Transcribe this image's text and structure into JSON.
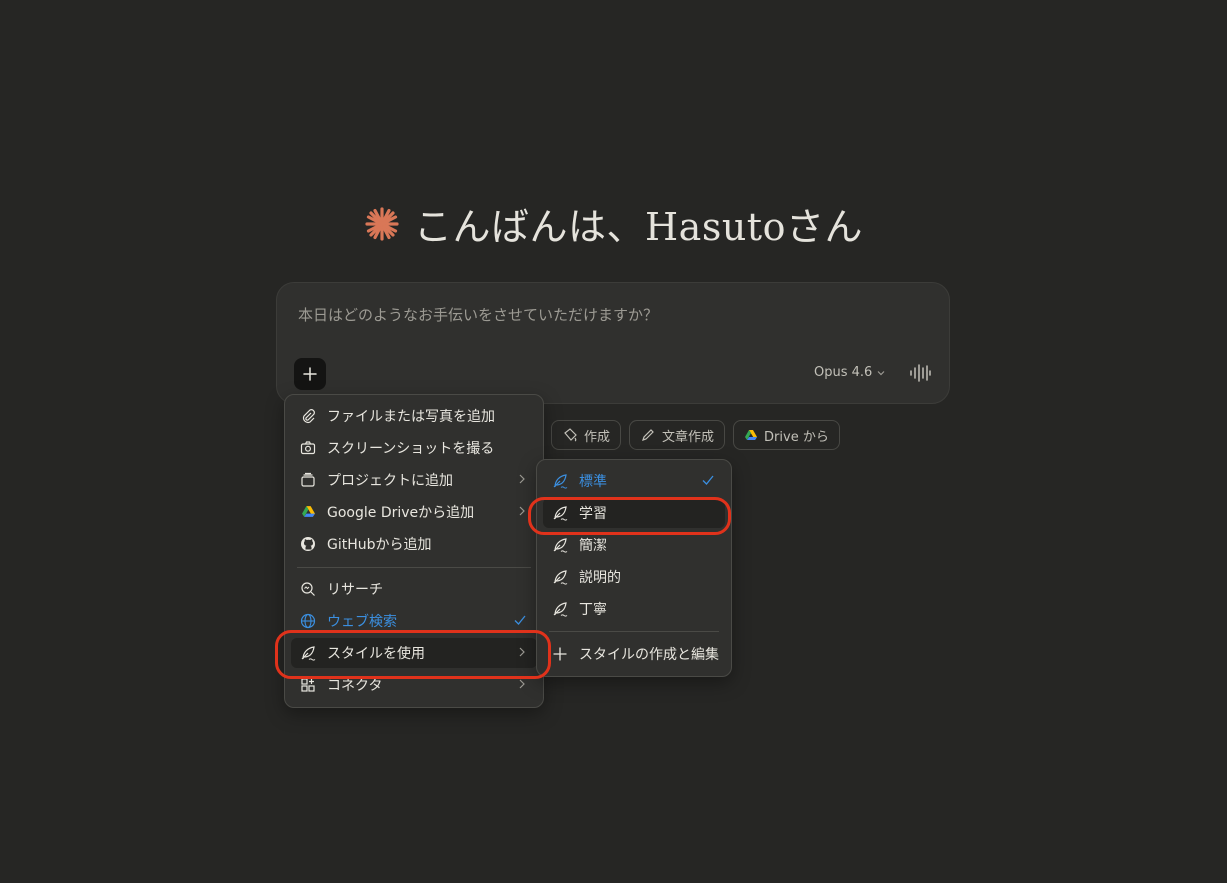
{
  "greeting": {
    "text": "こんばんは、Hasutoさん",
    "accent_color": "#d97757"
  },
  "composer": {
    "placeholder": "本日はどのようなお手伝いをさせていただけますか？",
    "model_label": "Opus 4.6",
    "plus_icon": "plus-icon",
    "voice_icon": "voice-icon"
  },
  "chips": [
    {
      "label": "作成",
      "icon": "paint-icon"
    },
    {
      "label": "文章作成",
      "icon": "pencil-icon"
    },
    {
      "label": "Drive から",
      "icon": "google-drive-icon"
    }
  ],
  "menu": {
    "items": [
      {
        "label": "ファイルまたは写真を追加",
        "icon": "paperclip-icon"
      },
      {
        "label": "スクリーンショットを撮る",
        "icon": "camera-icon"
      },
      {
        "label": "プロジェクトに追加",
        "icon": "project-icon"
      },
      {
        "label": "Google Driveから追加",
        "icon": "google-drive-icon"
      },
      {
        "label": "GitHubから追加",
        "icon": "github-icon"
      },
      {
        "label": "リサーチ",
        "icon": "research-icon"
      },
      {
        "label": "ウェブ検索",
        "icon": "globe-icon",
        "checked": true
      },
      {
        "label": "スタイルを使用",
        "icon": "feather-icon"
      },
      {
        "label": "コネクタ",
        "icon": "connector-icon"
      }
    ]
  },
  "submenu": {
    "items": [
      {
        "label": "標準",
        "icon": "feather-icon",
        "checked": true
      },
      {
        "label": "学習",
        "icon": "feather-icon"
      },
      {
        "label": "簡潔",
        "icon": "feather-icon"
      },
      {
        "label": "説明的",
        "icon": "feather-icon"
      },
      {
        "label": "丁寧",
        "icon": "feather-icon"
      }
    ],
    "create_label": "スタイルの作成と編集"
  },
  "colors": {
    "selected_blue": "#3b8fe0",
    "highlight_ring": "#e0321b"
  }
}
